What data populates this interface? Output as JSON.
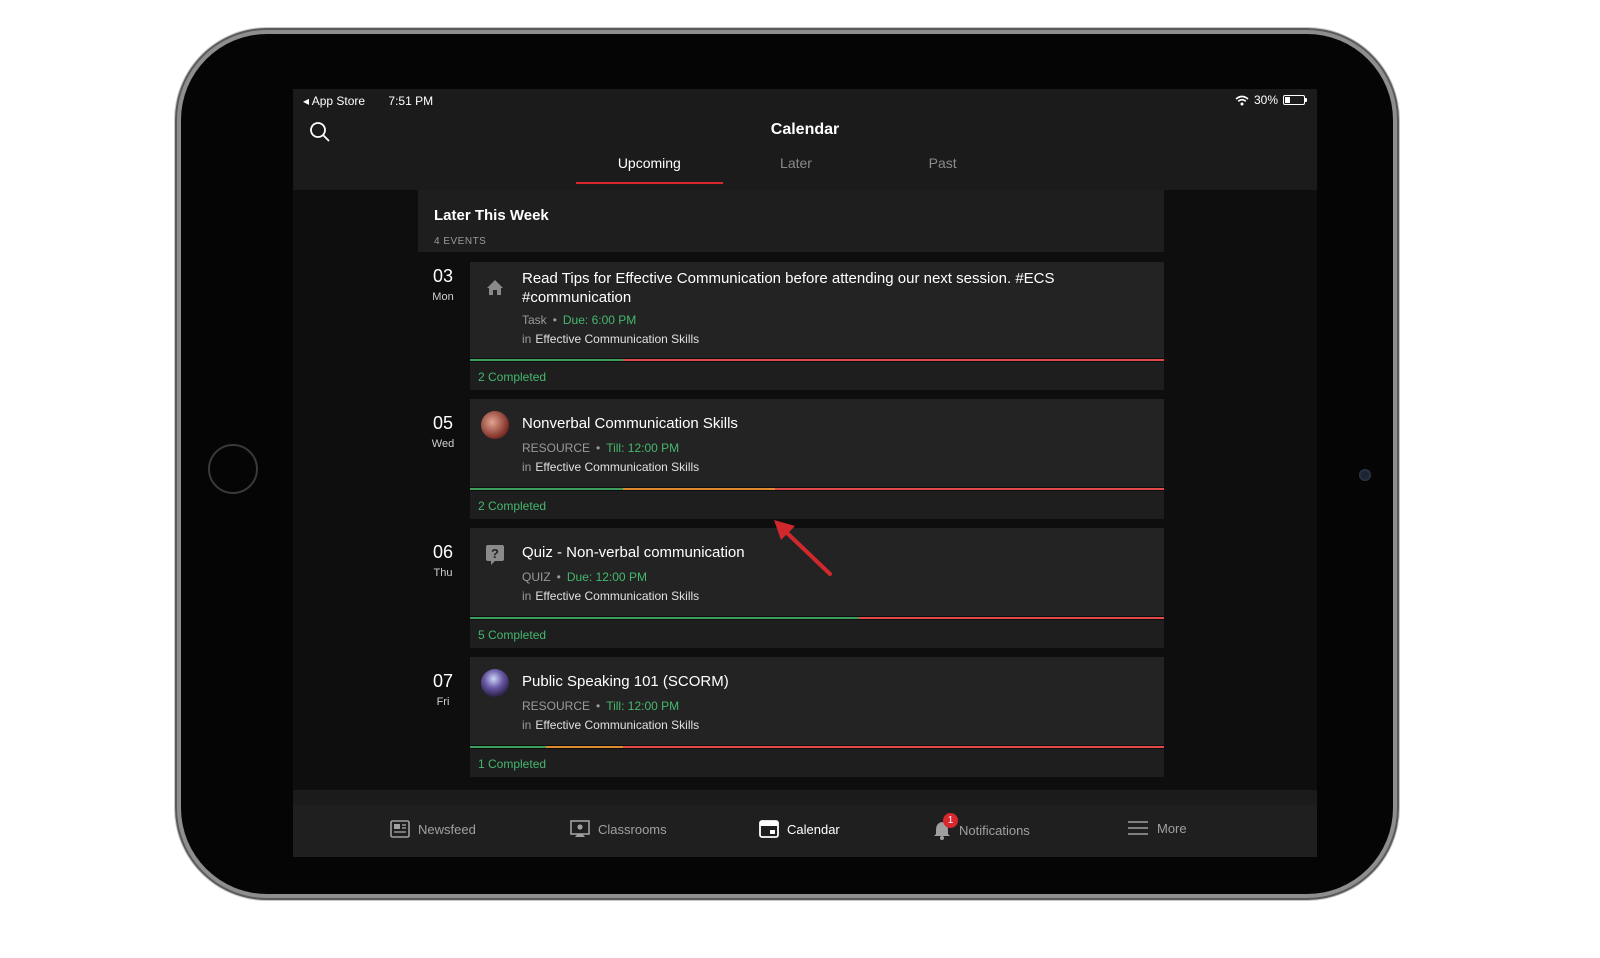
{
  "status_bar": {
    "back_app": "App Store",
    "time": "7:51 PM",
    "battery": "30%"
  },
  "header": {
    "title": "Calendar"
  },
  "tabs": [
    {
      "label": "Upcoming",
      "active": true
    },
    {
      "label": "Later",
      "active": false
    },
    {
      "label": "Past",
      "active": false
    }
  ],
  "section": {
    "title": "Later This Week",
    "count": "4 EVENTS"
  },
  "events": [
    {
      "day": "03",
      "weekday": "Mon",
      "icon": "home-icon",
      "title": "Read Tips for Effective Communication  before attending our next session.  #ECS #communication",
      "type": "Task",
      "time_label": "Due:",
      "time": "6:00 PM",
      "course_prefix": "in",
      "course": "Effective Communication Skills",
      "completed": "2 Completed",
      "progress": {
        "green": 0.22,
        "orange": 0.0
      }
    },
    {
      "day": "05",
      "weekday": "Wed",
      "icon": "resource-thumbnail-icon",
      "title": "Nonverbal Communication Skills",
      "type": "RESOURCE",
      "time_label": "Till:",
      "time": "12:00 PM",
      "course_prefix": "in",
      "course": "Effective Communication Skills",
      "completed": "2 Completed",
      "progress": {
        "green": 0.22,
        "orange": 0.22
      }
    },
    {
      "day": "06",
      "weekday": "Thu",
      "icon": "quiz-question-icon",
      "title": "Quiz - Non-verbal communication",
      "type": "QUIZ",
      "time_label": "Due:",
      "time": "12:00 PM",
      "course_prefix": "in",
      "course": "Effective Communication Skills",
      "completed": "5 Completed",
      "progress": {
        "green": 0.56,
        "orange": 0.0
      }
    },
    {
      "day": "07",
      "weekday": "Fri",
      "icon": "resource-thumbnail-icon",
      "title": "Public Speaking 101 (SCORM)",
      "type": "RESOURCE",
      "time_label": "Till:",
      "time": "12:00 PM",
      "course_prefix": "in",
      "course": "Effective Communication Skills",
      "completed": "1 Completed",
      "progress": {
        "green": 0.11,
        "orange": 0.11
      }
    }
  ],
  "bottom_nav": [
    {
      "label": "Newsfeed",
      "icon": "newsfeed-icon",
      "active": false
    },
    {
      "label": "Classrooms",
      "icon": "classrooms-icon",
      "active": false
    },
    {
      "label": "Calendar",
      "icon": "calendar-icon",
      "active": true
    },
    {
      "label": "Notifications",
      "icon": "bell-icon",
      "active": false,
      "badge": "1"
    },
    {
      "label": "More",
      "icon": "menu-icon",
      "active": false
    }
  ],
  "colors": {
    "accent_red": "#d9272e",
    "success_green": "#45b86e",
    "warning_orange": "#e08a30"
  }
}
